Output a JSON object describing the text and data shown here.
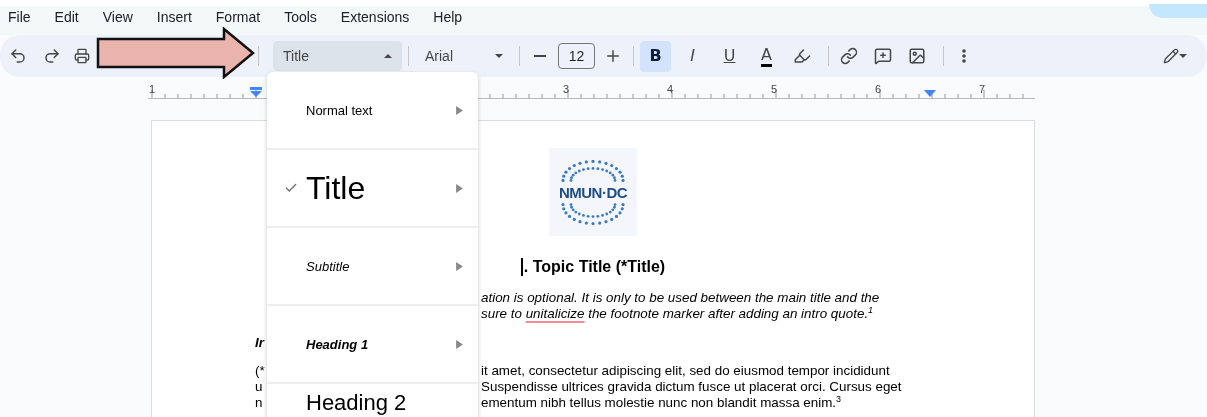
{
  "menu_bar": [
    "File",
    "Edit",
    "View",
    "Insert",
    "Format",
    "Tools",
    "Extensions",
    "Help"
  ],
  "toolbar": {
    "style_dropdown": "Title",
    "font_dropdown": "Arial",
    "font_size": "12",
    "format_buttons": [
      {
        "kind": "bold",
        "label": "B",
        "selected": true
      },
      {
        "kind": "italic",
        "label": "I",
        "selected": false
      },
      {
        "kind": "underline",
        "label": "U",
        "selected": false
      },
      {
        "kind": "text_color",
        "label": "A",
        "selected": false
      }
    ]
  },
  "ruler": {
    "labels": [
      "1",
      "3",
      "4",
      "5",
      "6",
      "7"
    ]
  },
  "style_menu": {
    "items": [
      {
        "kind": "normal",
        "label": "Normal text",
        "checked": false
      },
      {
        "kind": "title",
        "label": "Title",
        "checked": true
      },
      {
        "kind": "subtitle",
        "label": "Subtitle",
        "checked": false
      },
      {
        "kind": "heading1",
        "label": "Heading 1",
        "checked": false
      },
      {
        "kind": "heading2",
        "label": "Heading 2",
        "checked": false
      }
    ]
  },
  "document": {
    "logo": "NMUN·DC",
    "heading": ". Topic Title (*Title)",
    "intro_lines": [
      {
        "text": "ation is optional. It is only to be used between the main title and the"
      },
      {
        "text": "sure to ",
        "flagged": "unitalicize",
        "after": " the footnote marker after adding an intro quote.$^{1}$"
      }
    ],
    "section_fragment": "Ir",
    "left_fragments": [
      "(*",
      "u",
      "n"
    ],
    "body_lines": [
      "it amet, consectetur adipiscing elit, sed do eiusmod tempor incididunt",
      "Suspendisse ultrices gravida dictum fusce ut placerat orci. Cursus eget",
      "ementum nibh tellus molestie nunc non blandit massa enim.$^{3}$"
    ]
  }
}
